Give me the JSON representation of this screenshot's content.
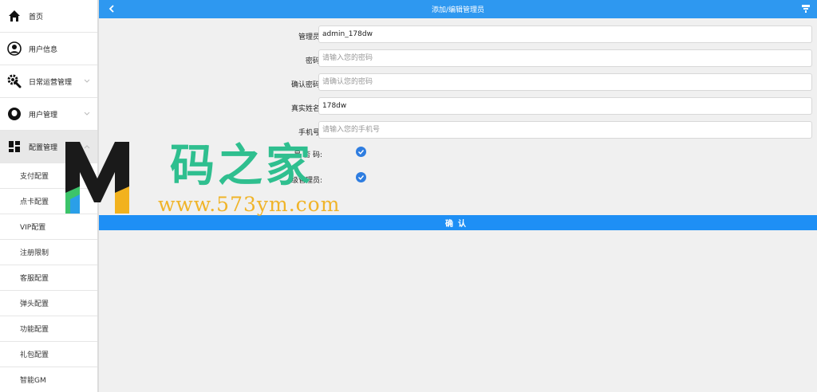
{
  "sidebar": {
    "items": [
      {
        "label": "首页",
        "icon": "home-icon"
      },
      {
        "label": "用户信息",
        "icon": "user-circle-icon"
      },
      {
        "label": "日常运营管理",
        "icon": "gear-icon"
      },
      {
        "label": "用户管理",
        "icon": "user-icon"
      },
      {
        "label": "配置管理",
        "icon": "grid-icon"
      }
    ],
    "sub_items": [
      {
        "label": "支付配置"
      },
      {
        "label": "点卡配置"
      },
      {
        "label": "VIP配置"
      },
      {
        "label": "注册限制"
      },
      {
        "label": "客服配置"
      },
      {
        "label": "弹头配置"
      },
      {
        "label": "功能配置"
      },
      {
        "label": "礼包配置"
      },
      {
        "label": "智能GM"
      }
    ]
  },
  "header": {
    "title": "添加/编辑管理员"
  },
  "form": {
    "admin_label": "管理员:",
    "admin_value": "admin_178dw",
    "password_label": "密码:",
    "password_placeholder": "请输入您的密码",
    "confirm_password_label": "确认密码:",
    "confirm_password_placeholder": "请确认您的密码",
    "realname_label": "真实姓名:",
    "realname_value": "178dw",
    "phone_label": "手机号:",
    "phone_placeholder": "请输入您的手机号",
    "check1_label": "是  否  码:",
    "check2_label": "   级管理员:",
    "confirm_label": "确认"
  },
  "watermark": {
    "cn": "码之家",
    "url": "www.573ym.com"
  },
  "colors": {
    "primary": "#2e98f0",
    "button": "#1e8ff5",
    "check": "#2e7de0"
  }
}
